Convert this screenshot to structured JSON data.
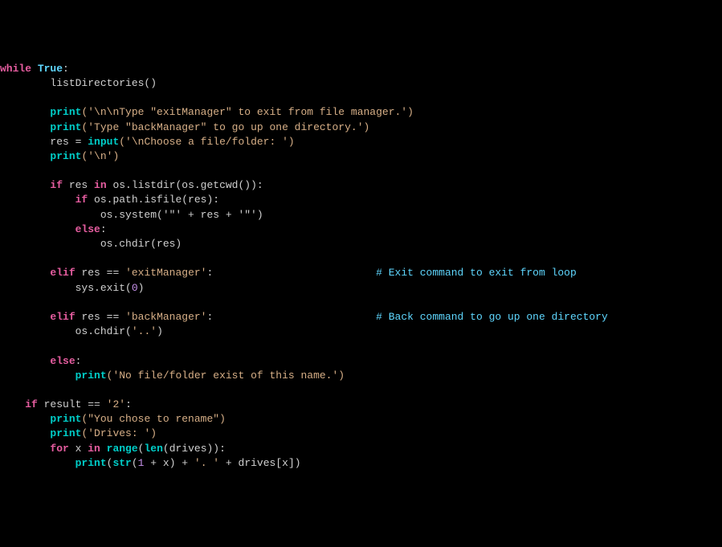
{
  "code": {
    "l1_kw1": "while",
    "l1_bool": "True",
    "l1_colon": ":",
    "l2": "        listDirectories()",
    "l3_pad": "        ",
    "l3_fn": "print",
    "l3_rest": "('\\n\\nType \"exitManager\" to exit from file manager.')",
    "l4_pad": "        ",
    "l4_fn": "print",
    "l4_rest": "('Type \"backManager\" to go up one directory.')",
    "l5_pad": "        ",
    "l5_lhs": "res = ",
    "l5_fn": "input",
    "l5_rest": "('\\nChoose a file/folder: ')",
    "l6_pad": "        ",
    "l6_fn": "print",
    "l6_rest": "('\\n')",
    "l7_pad": "        ",
    "l7_kw1": "if",
    "l7_mid1": " res ",
    "l7_kw2": "in",
    "l7_rest": " os.listdir(os.getcwd()):",
    "l8_pad": "            ",
    "l8_kw": "if",
    "l8_rest": " os.path.isfile(res):",
    "l9": "                os.system('\"' + res + '\"')",
    "l10_pad": "            ",
    "l10_kw": "else",
    "l10_colon": ":",
    "l11": "                os.chdir(res)",
    "l12_pad": "        ",
    "l12_kw": "elif",
    "l12_mid": " res == ",
    "l12_str": "'exitManager'",
    "l12_colon": ":",
    "l12_sp": "                          ",
    "l12_comment": "# Exit command to exit from loop",
    "l13_pad": "            ",
    "l13_rest": "sys.exit(",
    "l13_num": "0",
    "l13_close": ")",
    "l14_pad": "        ",
    "l14_kw": "elif",
    "l14_mid": " res == ",
    "l14_str": "'backManager'",
    "l14_colon": ":",
    "l14_sp": "                          ",
    "l14_comment": "# Back command to go up one directory",
    "l15_pad": "            ",
    "l15_rest": "os.chdir(",
    "l15_str": "'..'",
    "l15_close": ")",
    "l16_pad": "        ",
    "l16_kw": "else",
    "l16_colon": ":",
    "l17_pad": "            ",
    "l17_fn": "print",
    "l17_rest": "('No file/folder exist of this name.')",
    "l18_pad": "    ",
    "l18_kw": "if",
    "l18_mid": " result == ",
    "l18_str": "'2'",
    "l18_colon": ":",
    "l19_pad": "        ",
    "l19_fn": "print",
    "l19_rest": "(\"You chose to rename\")",
    "l20_pad": "        ",
    "l20_fn": "print",
    "l20_rest": "('Drives: ')",
    "l21_pad": "        ",
    "l21_kw1": "for",
    "l21_mid1": " x ",
    "l21_kw2": "in",
    "l21_sp": " ",
    "l21_fn1": "range",
    "l21_op": "(",
    "l21_fn2": "len",
    "l21_rest": "(drives)):",
    "l22_pad": "            ",
    "l22_fn1": "print",
    "l22_op1": "(",
    "l22_fn2": "str",
    "l22_op2": "(",
    "l22_num": "1",
    "l22_mid": " + x) + ",
    "l22_str": "'. '",
    "l22_rest": " + drives[x])"
  }
}
